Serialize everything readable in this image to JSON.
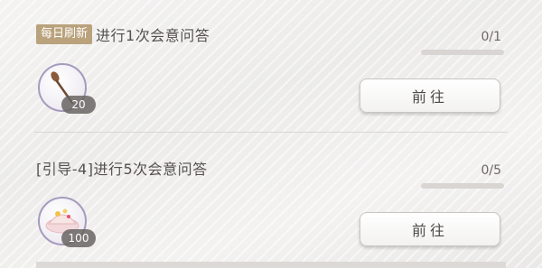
{
  "tasks": [
    {
      "badge": "每日刷新",
      "title": "进行1次会意问答",
      "progress_text": "0/1",
      "progress_fraction": 0,
      "reward_icon": "spoon-icon",
      "reward_qty": "20",
      "button_label": "前往"
    },
    {
      "badge": "",
      "title": "[引导-4]进行5次会意问答",
      "progress_text": "0/5",
      "progress_fraction": 0,
      "reward_icon": "dessert-icon",
      "reward_qty": "100",
      "button_label": "前往"
    }
  ],
  "colors": {
    "badge_bg": "#b9a27c",
    "progress_fill": "#a9917c",
    "icon_border": "#a69bbd"
  }
}
